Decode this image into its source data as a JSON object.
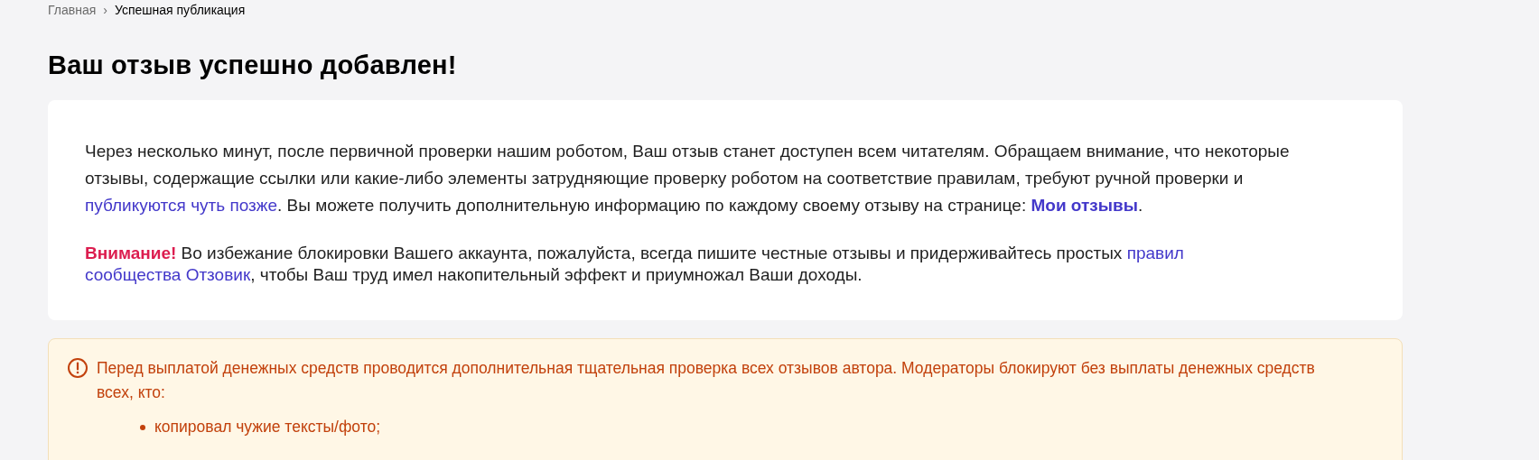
{
  "breadcrumbs": [
    {
      "label": "Главная",
      "kind": "link"
    },
    {
      "label": "›",
      "kind": "separator"
    },
    {
      "label": "Успешная публикация",
      "kind": "current"
    }
  ],
  "title": "Ваш отзыв успешно добавлен!",
  "card": {
    "paragraphs": [
      [
        {
          "kind": "text",
          "text": "Через несколько минут, после первичной проверки нашим роботом, Ваш отзыв станет доступен всем читателям. Обращаем внимание, что некоторые отзывы, содержащие ссылки или какие-либо элементы затрудняющие проверку роботом на соответствие правилам, требуют ручной проверки и "
        },
        {
          "kind": "link",
          "text": "публикуются чуть позже"
        },
        {
          "kind": "text",
          "text": ". Вы можете получить дополнительную информацию по каждому своему отзыву на странице: "
        },
        {
          "kind": "strong_link",
          "text": "Мои отзывы"
        },
        {
          "kind": "text",
          "text": "."
        }
      ],
      [
        {
          "kind": "alert",
          "text": "Внимание!"
        },
        {
          "kind": "text",
          "text": " Во избежание блокировки Вашего аккаунта, пожалуйста, всегда пишите честные отзывы и придерживайтесь простых "
        },
        {
          "kind": "link",
          "text": "правил"
        },
        {
          "kind": "linebreak"
        },
        {
          "kind": "link",
          "text": "сообщества Отзовик"
        },
        {
          "kind": "text",
          "text": ", чтобы Ваш труд имел накопительный эффект и приумножал Ваши доходы."
        }
      ]
    ]
  },
  "warning": {
    "text": "Перед выплатой денежных средств проводится дополнительная тщательная проверка всех отзывов автора. Модераторы блокируют без выплаты денежных средств всех, кто:",
    "items": [
      "копировал чужие тексты/фото;"
    ]
  }
}
